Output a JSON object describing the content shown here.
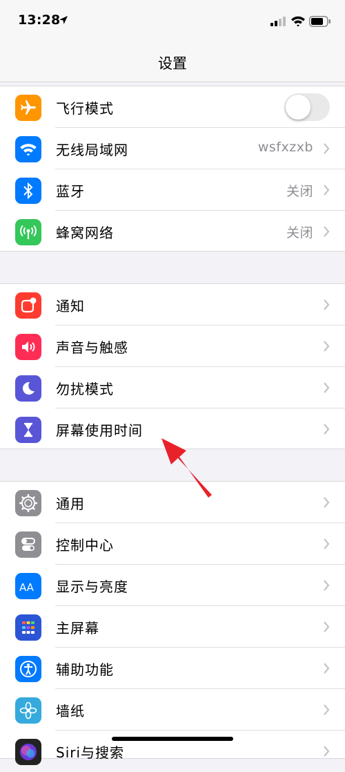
{
  "status": {
    "time": "13:28"
  },
  "nav": {
    "title": "设置"
  },
  "group1": [
    {
      "label": "飞行模式",
      "icon": "airplane-icon",
      "color": "#ff9500",
      "toggle": false
    },
    {
      "label": "无线局域网",
      "icon": "wifi-icon",
      "color": "#007aff",
      "value": "wsfxzxb"
    },
    {
      "label": "蓝牙",
      "icon": "bluetooth-icon",
      "color": "#007aff",
      "value": "关闭"
    },
    {
      "label": "蜂窝网络",
      "icon": "cellular-icon",
      "color": "#34c759",
      "value": "关闭"
    }
  ],
  "group2": [
    {
      "label": "通知",
      "icon": "notifications-icon",
      "color": "#ff3b30"
    },
    {
      "label": "声音与触感",
      "icon": "speaker-icon",
      "color": "#ff2d55"
    },
    {
      "label": "勿扰模式",
      "icon": "moon-icon",
      "color": "#5856d6"
    },
    {
      "label": "屏幕使用时间",
      "icon": "hourglass-icon",
      "color": "#5856d6"
    }
  ],
  "group3": [
    {
      "label": "通用",
      "icon": "gear-icon",
      "color": "#8e8e93"
    },
    {
      "label": "控制中心",
      "icon": "control-center-icon",
      "color": "#8e8e93"
    },
    {
      "label": "显示与亮度",
      "icon": "display-aa-icon",
      "color": "#007aff"
    },
    {
      "label": "主屏幕",
      "icon": "home-screen-icon",
      "color": "#2c55d6"
    },
    {
      "label": "辅助功能",
      "icon": "accessibility-icon",
      "color": "#007aff"
    },
    {
      "label": "墙纸",
      "icon": "wallpaper-flower-icon",
      "color": "#36aadc"
    },
    {
      "label": "Siri与搜索",
      "icon": "siri-icon",
      "color": "#222222"
    }
  ],
  "annotation": {
    "arrow_color": "#e8222a"
  }
}
